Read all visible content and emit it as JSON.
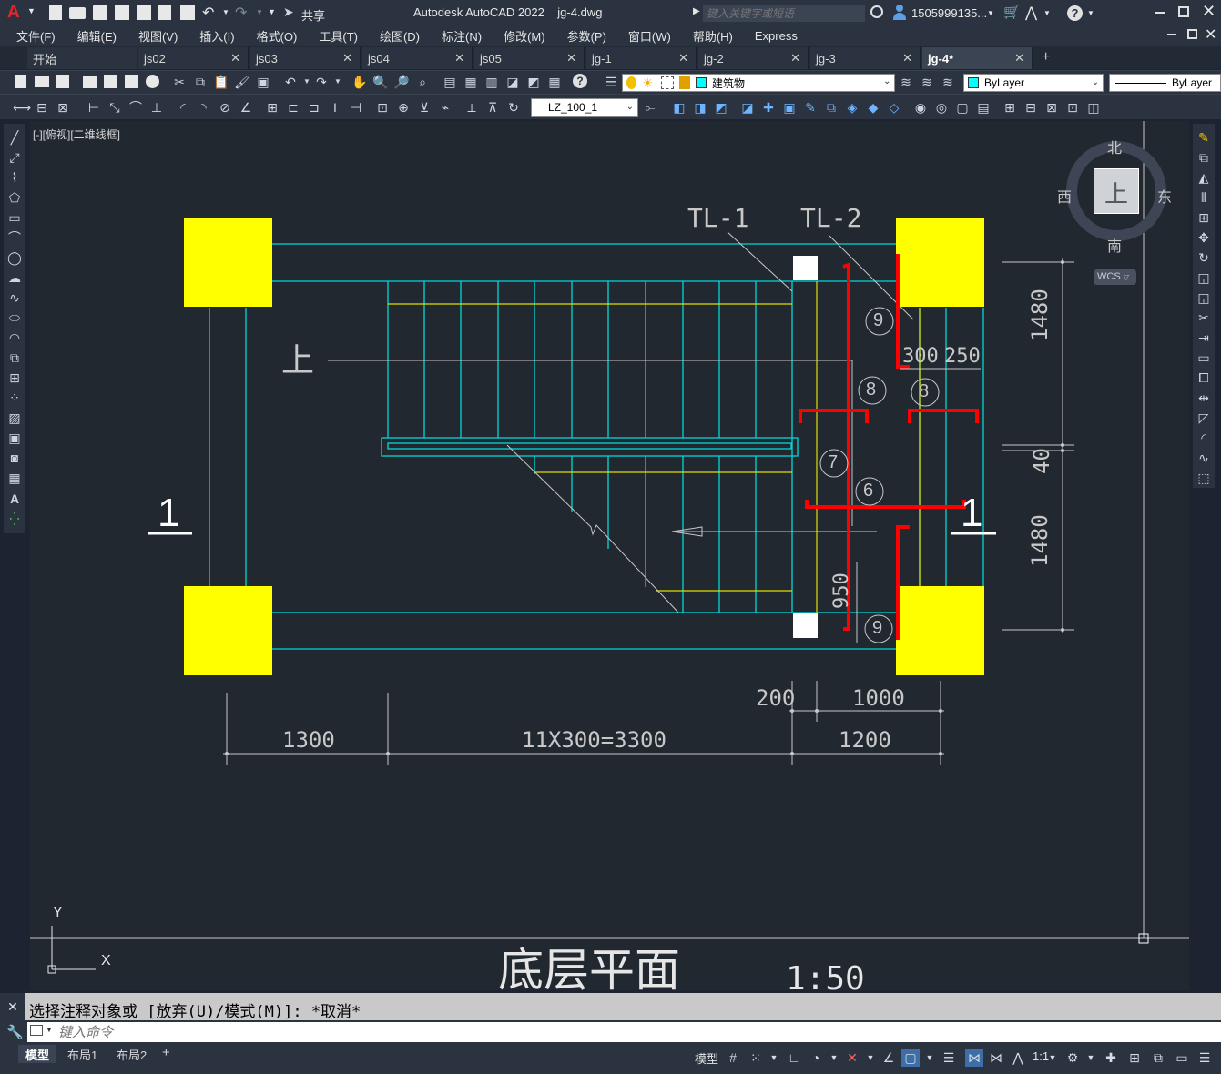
{
  "title_bar": {
    "app_title": "Autodesk AutoCAD 2022",
    "file_name": "jg-4.dwg",
    "share_label": "共享",
    "search_placeholder": "键入关键字或短语",
    "user_name": "1505999135...",
    "colors": {
      "logo": "#e8232c",
      "bar": "#2b3340"
    }
  },
  "menu": {
    "items": [
      "文件(F)",
      "编辑(E)",
      "视图(V)",
      "插入(I)",
      "格式(O)",
      "工具(T)",
      "绘图(D)",
      "标注(N)",
      "修改(M)",
      "参数(P)",
      "窗口(W)",
      "帮助(H)",
      "Express"
    ]
  },
  "doc_tabs": {
    "items": [
      {
        "label": "开始",
        "closable": false,
        "active": false
      },
      {
        "label": "js02",
        "closable": true,
        "active": false
      },
      {
        "label": "js03",
        "closable": true,
        "active": false
      },
      {
        "label": "js04",
        "closable": true,
        "active": false
      },
      {
        "label": "js05",
        "closable": true,
        "active": false
      },
      {
        "label": "jg-1",
        "closable": true,
        "active": false
      },
      {
        "label": "jg-2",
        "closable": true,
        "active": false
      },
      {
        "label": "jg-3",
        "closable": true,
        "active": false
      },
      {
        "label": "jg-4*",
        "closable": true,
        "active": true
      }
    ],
    "add_label": "+"
  },
  "toolbar": {
    "layer_name": "建筑物",
    "layer_color": "#00ffff",
    "color_value": "ByLayer",
    "linetype_value": "ByLayer",
    "dimstyle_value": "LZ_100_1"
  },
  "viewport": {
    "label": "[-][俯视][二维线框]",
    "viewcube": {
      "top": "上",
      "north": "北",
      "south": "南",
      "east": "东",
      "west": "西",
      "wcs": "WCS"
    },
    "ucs": {
      "x": "X",
      "y": "Y"
    }
  },
  "drawing": {
    "beam_labels": [
      "TL-1",
      "TL-2"
    ],
    "up_label": "上",
    "section_mark": "1",
    "rebar_numbers": [
      "9",
      "8",
      "8",
      "7",
      "6",
      "9"
    ],
    "dims_horizontal": [
      "1300",
      "11X300=3300",
      "1200",
      "200",
      "1000",
      "300",
      "250"
    ],
    "dims_vertical": [
      "1480",
      "40",
      "1480",
      "950"
    ],
    "title": "底层平面",
    "scale": "1:50",
    "colors": {
      "column": "#ffff00",
      "stair": "#00d8d8",
      "rebar": "#ff0000",
      "dim": "#c8c8c8",
      "yellow_line": "#e0e000"
    }
  },
  "command": {
    "history": "选择注释对象或 [放弃(U)/模式(M)]: *取消*",
    "placeholder": "键入命令"
  },
  "layout_tabs": [
    "模型",
    "布局1",
    "布局2"
  ],
  "status": {
    "model": "模型",
    "scale": "1:1"
  }
}
